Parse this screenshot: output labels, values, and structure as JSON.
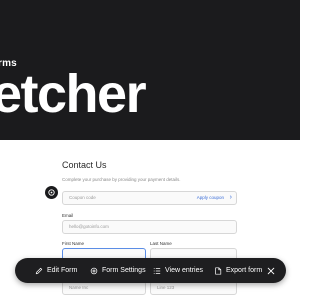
{
  "hero": {
    "kicker": "rms",
    "brand": "etcher"
  },
  "form": {
    "title": "Contact Us",
    "subtitle": "Complete your purchase by providing your payment details.",
    "coupon": {
      "placeholder": "Coupon code",
      "apply_label": "Apply coupon",
      "chevron": "›"
    },
    "email": {
      "label": "Email",
      "placeholder": "hello@gotoinfo.com"
    },
    "first_name": {
      "label": "First Name"
    },
    "last_name": {
      "label": "Last Name"
    },
    "row3": {
      "left_value": "Name Inc",
      "right_value": "Line 123"
    }
  },
  "toolbar": {
    "edit_label": "Edit Form",
    "settings_label": "Form Settings",
    "entries_label": "View entries",
    "export_label": "Export form",
    "icons": [
      "pencil-icon",
      "gear-icon",
      "list-icon",
      "export-icon",
      "close-icon"
    ]
  },
  "colors": {
    "hero_bg": "#1b1b1d",
    "toolbar_bg": "#1e1e20",
    "link": "#3b6ed8",
    "focus": "#5b8de6"
  }
}
